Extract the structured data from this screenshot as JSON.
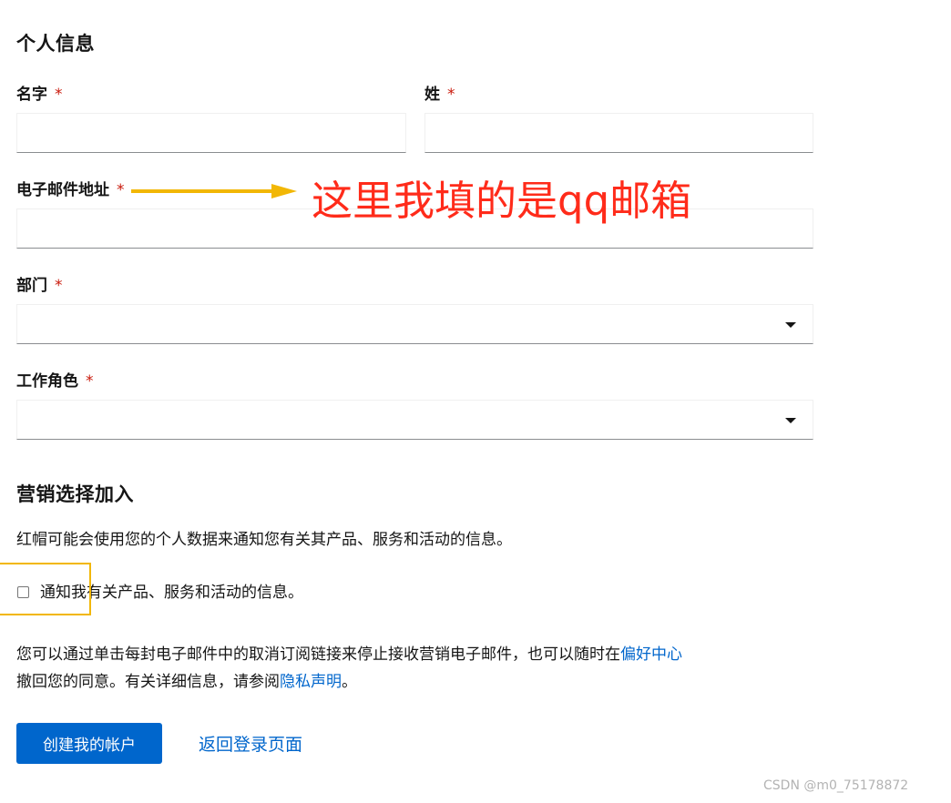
{
  "personal": {
    "heading": "个人信息",
    "first_name": {
      "label": "名字",
      "required": "*",
      "value": ""
    },
    "last_name": {
      "label": "姓",
      "required": "*",
      "value": ""
    },
    "email": {
      "label": "电子邮件地址",
      "required": "*",
      "value": ""
    },
    "department": {
      "label": "部门",
      "required": "*",
      "selected": ""
    },
    "job_role": {
      "label": "工作角色",
      "required": "*",
      "selected": ""
    }
  },
  "marketing": {
    "heading": "营销选择加入",
    "description": "红帽可能会使用您的个人数据来通知您有关其产品、服务和活动的信息。",
    "checkbox_label": "通知我有关产品、服务和活动的信息。",
    "checkbox_checked": false,
    "unsubscribe_text_1": "您可以通过单击每封电子邮件中的取消订阅链接来停止接收营销电子邮件，也可以随时在",
    "preference_center_link": "偏好中心",
    "unsubscribe_text_2": "撤回您的同意。有关详细信息，请参阅",
    "privacy_link": "隐私声明",
    "unsubscribe_text_3": "。"
  },
  "actions": {
    "create_account": "创建我的帐户",
    "back_to_login": "返回登录页面"
  },
  "annotation": {
    "text": "这里我填的是qq邮箱",
    "arrow_color": "#f2b705",
    "text_color": "#ff2b1a"
  },
  "watermark": "CSDN @m0_75178872",
  "colors": {
    "primary": "#0066cc",
    "required": "#c9190b",
    "text": "#151515"
  }
}
